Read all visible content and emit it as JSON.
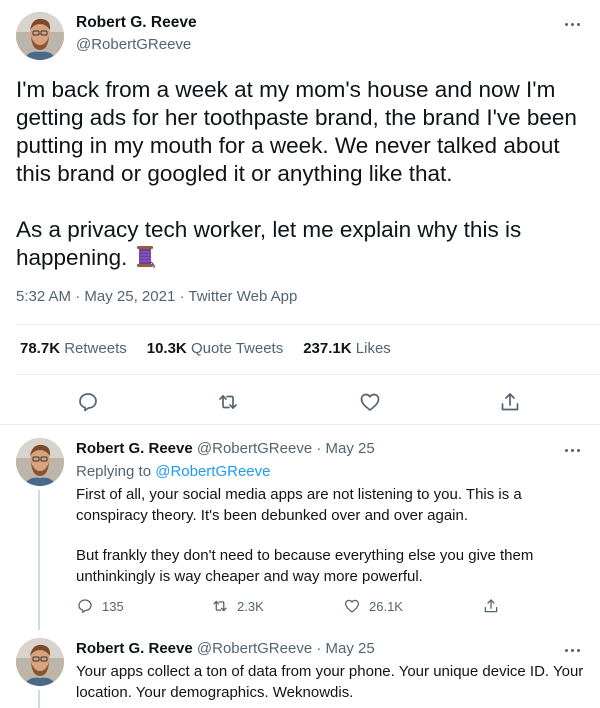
{
  "main_tweet": {
    "name": "Robert G. Reeve",
    "handle": "@RobertGReeve",
    "text": "I'm back from a week at my mom's house and now I'm getting ads for her toothpaste brand, the brand I've been putting in my mouth for a week. We never talked about this brand or googled it or anything like that.\n\nAs a privacy tech worker, let me explain why this is happening.",
    "emoji": "thread-spool-emoji",
    "time": "5:32 AM",
    "date": "May 25, 2021",
    "source": "Twitter Web App",
    "separator": "·",
    "stats": {
      "retweets_count": "78.7K",
      "retweets_label": "Retweets",
      "quotes_count": "10.3K",
      "quotes_label": "Quote Tweets",
      "likes_count": "237.1K",
      "likes_label": "Likes"
    }
  },
  "replies": [
    {
      "name": "Robert G. Reeve",
      "handle": "@RobertGReeve",
      "dot": "·",
      "date": "May 25",
      "replying_prefix": "Replying to",
      "replying_to": "@RobertGReeve",
      "paragraphs": [
        "First of all, your social media apps are not listening to you. This is a conspiracy theory. It's been debunked over and over again.",
        "But frankly they don't need to because everything else you give them unthinkingly is way cheaper and way more powerful."
      ],
      "reply_count": "135",
      "retweet_count": "2.3K",
      "like_count": "26.1K"
    },
    {
      "name": "Robert G. Reeve",
      "handle": "@RobertGReeve",
      "dot": "·",
      "date": "May 25",
      "paragraphs": [
        "Your apps collect a ton of data from your phone. Your unique device ID. Your location. Your demographics. Weknowdis."
      ]
    }
  ],
  "colors": {
    "text": "#0f1419",
    "secondary": "#536471",
    "link": "#1d9bf0",
    "divider": "#e6ecf0",
    "background": "#ffffff"
  }
}
